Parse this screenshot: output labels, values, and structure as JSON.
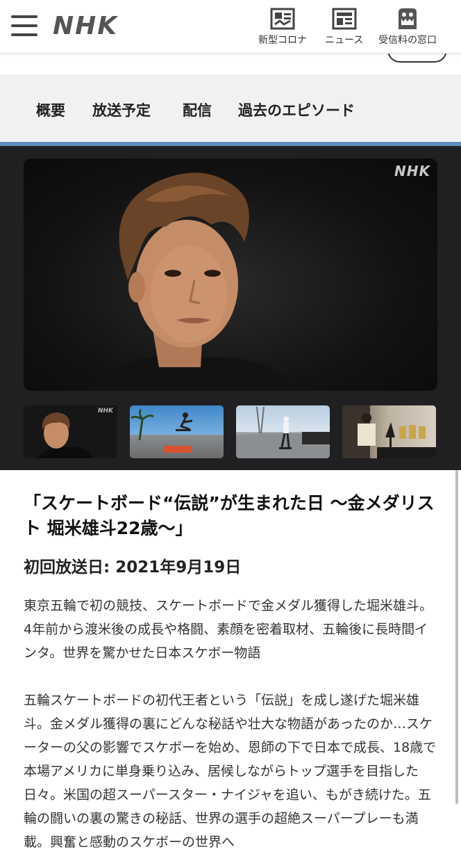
{
  "header": {
    "logo": "NHK",
    "nav": [
      {
        "label": "新型コロナ",
        "icon": "news-panel-icon"
      },
      {
        "label": "ニュース",
        "icon": "newspaper-icon"
      },
      {
        "label": "受信料の窓口",
        "icon": "domo-kun-icon"
      }
    ]
  },
  "tabs": [
    "概要",
    "放送予定",
    "配信",
    "過去のエピソード"
  ],
  "gallery": {
    "watermark": "NHK",
    "thumbnails": [
      "interview-portrait",
      "skater-air-palm-trees",
      "skatepark-ramp",
      "trophies-room"
    ]
  },
  "program": {
    "title": "「スケートボード“伝説”が生まれた日 〜金メダリスト 堀米雄斗22歳〜」",
    "airdate": "初回放送日: 2021年9月19日",
    "desc1": "東京五輪で初の競技、スケートボードで金メダル獲得した堀米雄斗。4年前から渡米後の成長や格闘、素顔を密着取材、五輪後に長時間インタ。世界を驚かせた日本スケボー物語",
    "desc2": "五輪スケートボードの初代王者という「伝説」を成し遂げた堀米雄斗。金メダル獲得の裏にどんな秘話や壮大な物語があったのか…スケーターの父の影響でスケボーを始め、恩師の下で日本で成長、18歳で本場アメリカに単身乗り込み、居候しながらトップ選手を目指した日々。米国の超スーパースター・ナイジャを追い、もがき続けた。五輪の闘いの裏の驚きの秘話、世界の選手の超絶スーパープレーも満載。興奮と感動のスケボーの世界へ"
  },
  "colors": {
    "accent_bar": "#5b8fbd",
    "gallery_bg": "#202022",
    "tab_bg": "#f1f1f1"
  }
}
